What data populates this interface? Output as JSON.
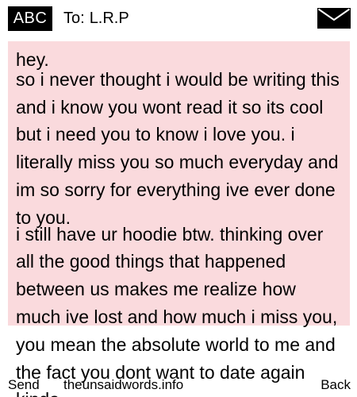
{
  "header": {
    "input_mode": "ABC",
    "to_label": "To:",
    "recipient": "L.R.P",
    "envelope_icon": "envelope-icon"
  },
  "message": {
    "paragraphs": [
      "hey.",
      "so i never thought i would be writing this and i know you wont read it so its cool but i need you to know i love you. i literally miss you so much everyday and im so sorry for everything ive ever done to you.",
      "i still have ur hoodie btw. thinking over all the good things that happened between us makes me realize how much ive lost and how much i miss you, you mean the absolute world to me and the fact you dont want to date again kinda"
    ],
    "background_color": "#fadadd"
  },
  "softkeys": {
    "left": "Send",
    "center": "theunsaidwords.info",
    "right": "Back"
  }
}
